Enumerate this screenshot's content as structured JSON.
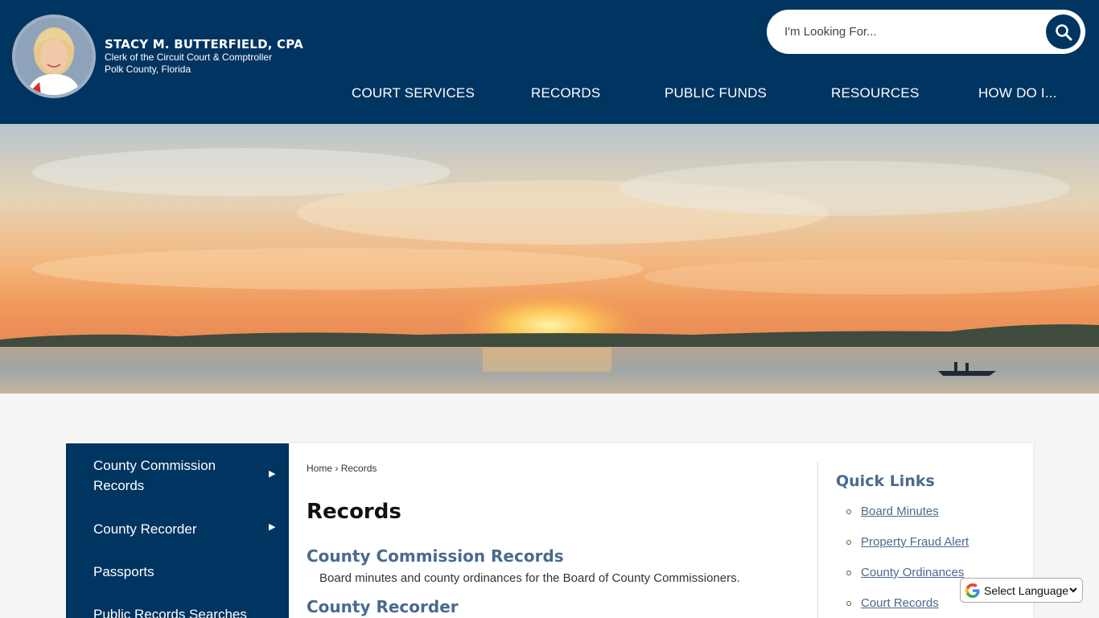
{
  "header": {
    "name": "STACY M. BUTTERFIELD, CPA",
    "line1": "Clerk of the Circuit Court & Comptroller",
    "line2": "Polk County, Florida"
  },
  "search": {
    "placeholder": "I'm Looking For..."
  },
  "nav": [
    {
      "label": "COURT SERVICES"
    },
    {
      "label": "RECORDS"
    },
    {
      "label": "PUBLIC FUNDS"
    },
    {
      "label": "RESOURCES"
    },
    {
      "label": "HOW DO I..."
    }
  ],
  "sidebar": {
    "items": [
      {
        "label": "County Commission Records",
        "has_submenu": true
      },
      {
        "label": "County Recorder",
        "has_submenu": true
      },
      {
        "label": "Passports",
        "has_submenu": false
      },
      {
        "label": "Public Records Searches",
        "has_submenu": false
      }
    ]
  },
  "main": {
    "breadcrumb": {
      "home": "Home",
      "sep": "›",
      "current": "Records"
    },
    "title": "Records",
    "sections": [
      {
        "title": "County Commission Records",
        "desc": "Board minutes and county ordinances for the Board of County Commissioners."
      },
      {
        "title": "County Recorder"
      }
    ]
  },
  "quick_links": {
    "title": "Quick Links",
    "items": [
      {
        "label": "Board Minutes"
      },
      {
        "label": "Property Fraud Alert"
      },
      {
        "label": "County Ordinances"
      },
      {
        "label": "Court Records"
      }
    ]
  },
  "translate": {
    "label": "Select Language"
  },
  "colors": {
    "navy": "#003461",
    "link": "#4a6a8e",
    "page_bg": "#f5f5f5"
  }
}
